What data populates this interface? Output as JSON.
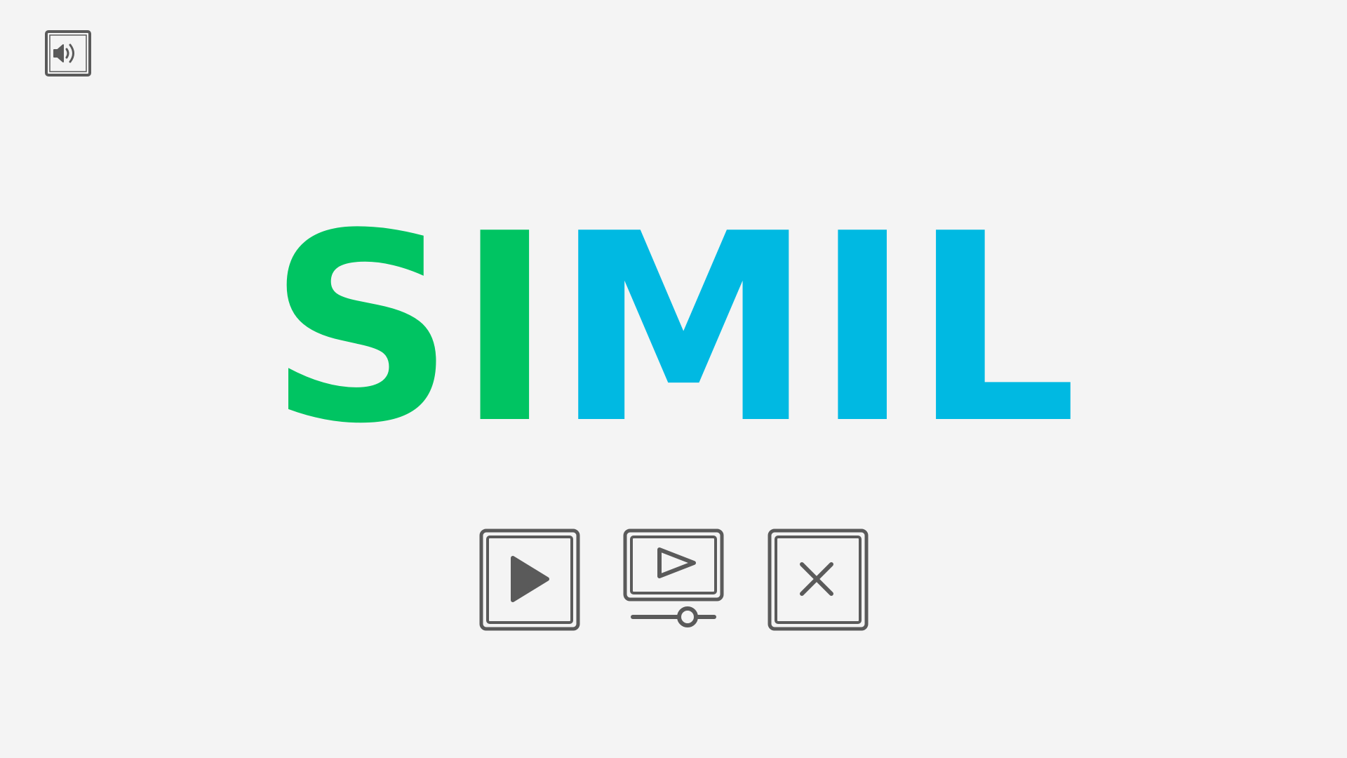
{
  "colors": {
    "background": "#f4f4f4",
    "icon": "#5a5a5a",
    "logo_green": "#00c462",
    "logo_blue": "#00b9e2"
  },
  "logo": {
    "part_a": "SI",
    "part_b": "MIL"
  },
  "buttons": {
    "sound": {
      "icon": "speaker-volume-icon"
    },
    "play": {
      "icon": "play-icon"
    },
    "video_settings": {
      "icon": "video-settings-icon"
    },
    "exit": {
      "icon": "close-icon"
    }
  }
}
